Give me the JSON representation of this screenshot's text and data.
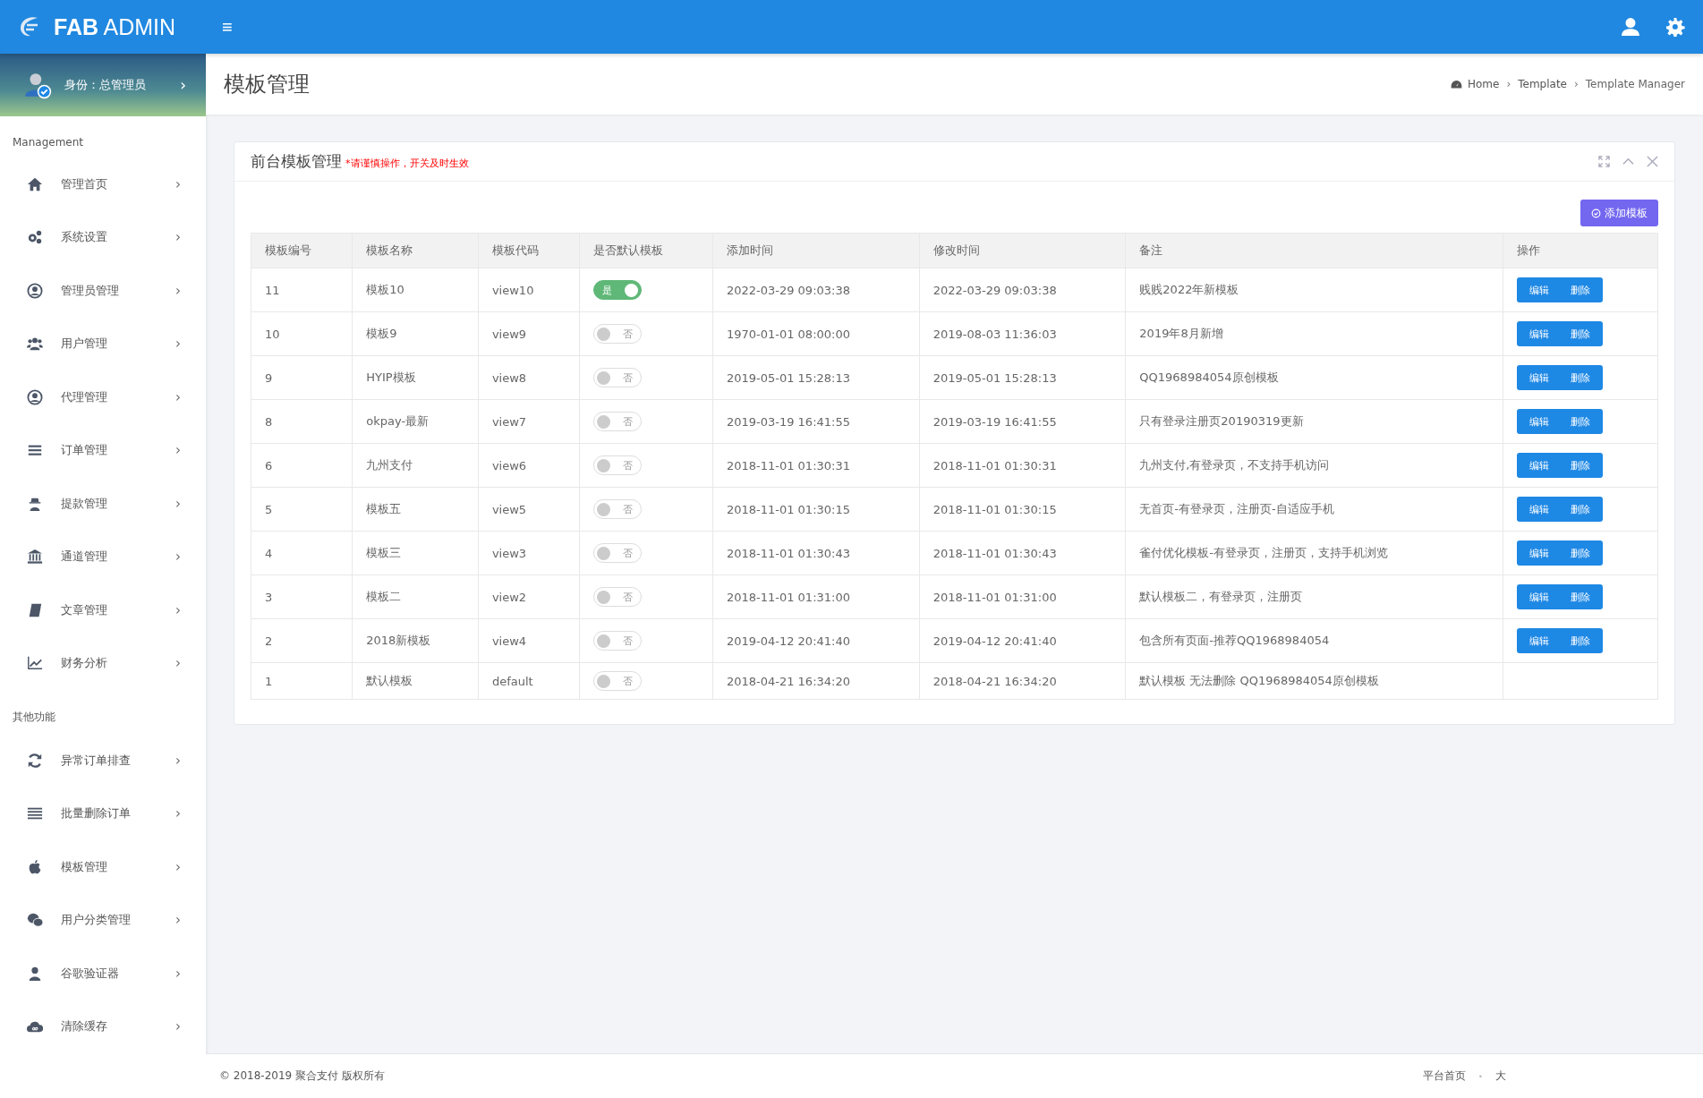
{
  "brand": {
    "bold": "FAB",
    "light": "ADMIN"
  },
  "topbar": {
    "menu_glyph": "≡"
  },
  "profile": {
    "label": "身份：总管理员",
    "chevron": "›"
  },
  "sidebar": {
    "sections": [
      {
        "title": "Management",
        "items": [
          {
            "label": "管理首页"
          },
          {
            "label": "系统设置"
          },
          {
            "label": "管理员管理"
          },
          {
            "label": "用户管理"
          },
          {
            "label": "代理管理"
          },
          {
            "label": "订单管理"
          },
          {
            "label": "提款管理"
          },
          {
            "label": "通道管理"
          },
          {
            "label": "文章管理"
          },
          {
            "label": "财务分析"
          }
        ]
      },
      {
        "title": "其他功能",
        "items": [
          {
            "label": "异常订单排查"
          },
          {
            "label": "批量删除订单"
          },
          {
            "label": "模板管理"
          },
          {
            "label": "用户分类管理"
          },
          {
            "label": "谷歌验证器"
          },
          {
            "label": "清除缓存"
          }
        ]
      }
    ],
    "chevron": "›"
  },
  "page": {
    "title": "模板管理",
    "breadcrumb": [
      "Home",
      "Template",
      "Template Manager"
    ],
    "separator": "›"
  },
  "card": {
    "title": "前台模板管理",
    "notice": "*请谨慎操作，开关及时生效",
    "add_button": "添加模板"
  },
  "table": {
    "columns": [
      "模板编号",
      "模板名称",
      "模板代码",
      "是否默认模板",
      "添加时间",
      "修改时间",
      "备注",
      "操作"
    ],
    "rows": [
      {
        "id": "11",
        "name": "模板10",
        "code": "view10",
        "is_default": true,
        "toggle": "是",
        "added": "2022-03-29 09:03:38",
        "modified": "2022-03-29 09:03:38",
        "note": "贱贱2022年新模板",
        "actions": [
          "编辑",
          "删除"
        ]
      },
      {
        "id": "10",
        "name": "模板9",
        "code": "view9",
        "is_default": false,
        "toggle": "否",
        "added": "1970-01-01 08:00:00",
        "modified": "2019-08-03 11:36:03",
        "note": "2019年8月新增",
        "actions": [
          "编辑",
          "删除"
        ]
      },
      {
        "id": "9",
        "name": "HYIP模板",
        "code": "view8",
        "is_default": false,
        "toggle": "否",
        "added": "2019-05-01 15:28:13",
        "modified": "2019-05-01 15:28:13",
        "note": "QQ1968984054原创模板",
        "actions": [
          "编辑",
          "删除"
        ]
      },
      {
        "id": "8",
        "name": "okpay-最新",
        "code": "view7",
        "is_default": false,
        "toggle": "否",
        "added": "2019-03-19 16:41:55",
        "modified": "2019-03-19 16:41:55",
        "note": "只有登录注册页20190319更新",
        "actions": [
          "编辑",
          "删除"
        ]
      },
      {
        "id": "6",
        "name": "九州支付",
        "code": "view6",
        "is_default": false,
        "toggle": "否",
        "added": "2018-11-01 01:30:31",
        "modified": "2018-11-01 01:30:31",
        "note": "九州支付,有登录页，不支持手机访问",
        "actions": [
          "编辑",
          "删除"
        ]
      },
      {
        "id": "5",
        "name": "模板五",
        "code": "view5",
        "is_default": false,
        "toggle": "否",
        "added": "2018-11-01 01:30:15",
        "modified": "2018-11-01 01:30:15",
        "note": "无首页-有登录页，注册页-自适应手机",
        "actions": [
          "编辑",
          "删除"
        ]
      },
      {
        "id": "4",
        "name": "模板三",
        "code": "view3",
        "is_default": false,
        "toggle": "否",
        "added": "2018-11-01 01:30:43",
        "modified": "2018-11-01 01:30:43",
        "note": "雀付优化模板-有登录页，注册页，支持手机浏览",
        "actions": [
          "编辑",
          "删除"
        ]
      },
      {
        "id": "3",
        "name": "模板二",
        "code": "view2",
        "is_default": false,
        "toggle": "否",
        "added": "2018-11-01 01:31:00",
        "modified": "2018-11-01 01:31:00",
        "note": "默认模板二，有登录页，注册页",
        "actions": [
          "编辑",
          "删除"
        ]
      },
      {
        "id": "2",
        "name": "2018新模板",
        "code": "view4",
        "is_default": false,
        "toggle": "否",
        "added": "2019-04-12 20:41:40",
        "modified": "2019-04-12 20:41:40",
        "note": "包含所有页面-推荐QQ1968984054",
        "actions": [
          "编辑",
          "删除"
        ]
      },
      {
        "id": "1",
        "name": "默认模板",
        "code": "default",
        "is_default": false,
        "toggle": "否",
        "added": "2018-04-21 16:34:20",
        "modified": "2018-04-21 16:34:20",
        "note": "默认模板 无法删除 QQ1968984054原创模板"
      }
    ]
  },
  "footer": {
    "copyright": "© 2018-2019 聚合支付 版权所有",
    "links": [
      "平台首页",
      "大"
    ],
    "separator": "•"
  }
}
